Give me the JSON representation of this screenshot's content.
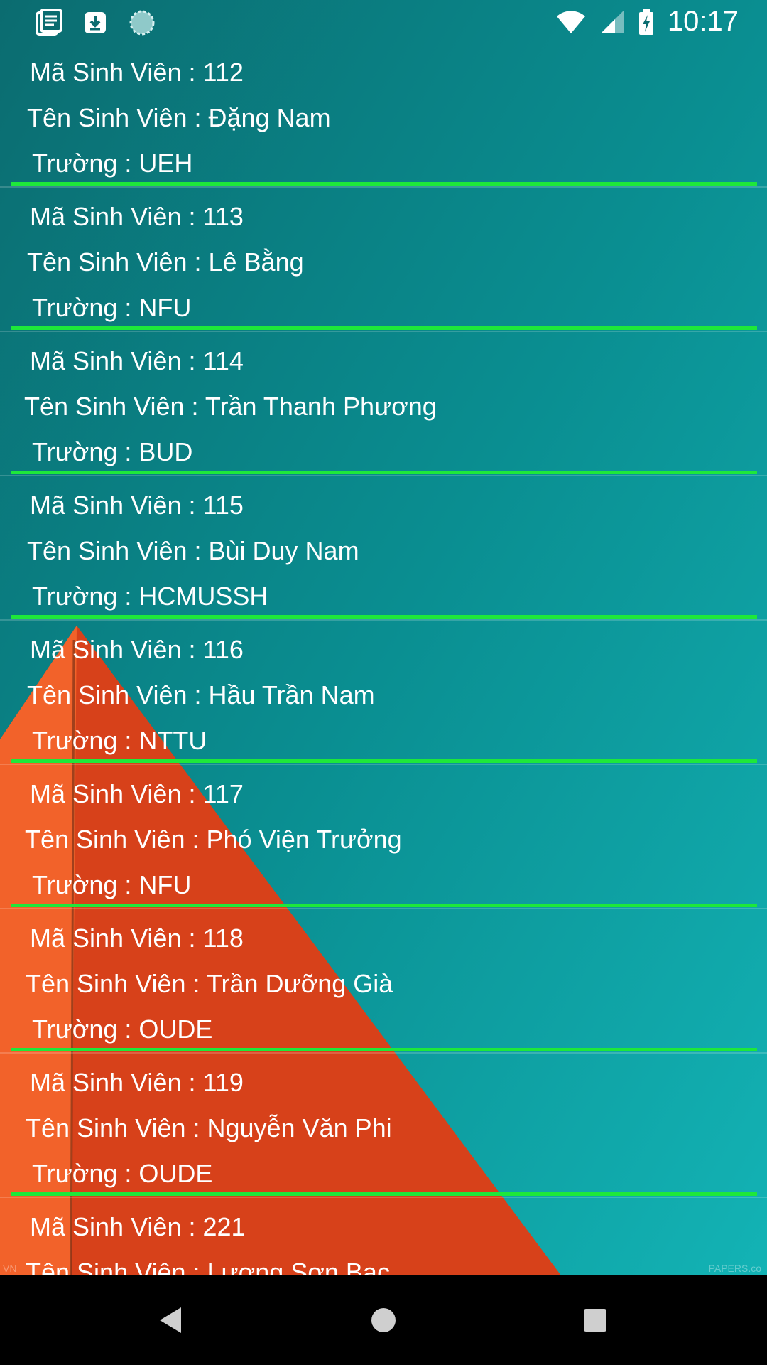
{
  "status_bar": {
    "time": "10:17",
    "left_icons": [
      "notes-icon",
      "download-icon",
      "sync-icon"
    ],
    "right_icons": [
      "wifi-icon",
      "signal-icon",
      "battery-charging-icon"
    ]
  },
  "students": [
    {
      "id_label": "Mã Sinh Viên : 112",
      "name_label": "Tên Sinh Viên : Đặng Nam",
      "school_label": "Trường : UEH"
    },
    {
      "id_label": "Mã Sinh Viên : 113",
      "name_label": "Tên Sinh Viên : Lê Bằng",
      "school_label": "Trường : NFU"
    },
    {
      "id_label": "Mã Sinh Viên : 114",
      "name_label": "Tên Sinh Viên : Trần Thanh Phương",
      "school_label": "Trường : BUD"
    },
    {
      "id_label": "Mã Sinh Viên : 115",
      "name_label": "Tên Sinh Viên : Bùi Duy Nam",
      "school_label": "Trường : HCMUSSH"
    },
    {
      "id_label": "Mã Sinh Viên : 116",
      "name_label": "Tên Sinh Viên : Hầu Trần Nam",
      "school_label": "Trường : NTTU"
    },
    {
      "id_label": "Mã Sinh Viên : 117",
      "name_label": "Tên Sinh Viên : Phó Viện Trưởng",
      "school_label": "Trường : NFU"
    },
    {
      "id_label": "Mã Sinh Viên : 118",
      "name_label": "Tên Sinh Viên : Trần Dưỡng Già",
      "school_label": "Trường : OUDE"
    },
    {
      "id_label": "Mã Sinh Viên : 119",
      "name_label": "Tên Sinh Viên : Nguyễn Văn Phi",
      "school_label": "Trường : OUDE"
    },
    {
      "id_label": "Mã Sinh Viên : 221",
      "name_label": "Tên Sinh Viên : Lương Sơn Bạc",
      "school_label": ""
    }
  ],
  "watermarks": {
    "left": "VN",
    "right": "PAPERS.co"
  },
  "nav_bar": {
    "buttons": [
      "back-icon",
      "home-icon",
      "recents-icon"
    ]
  },
  "colors": {
    "divider": "#1ee83a",
    "background_teal": "#0a6f73",
    "background_orange": "#e8451a"
  }
}
